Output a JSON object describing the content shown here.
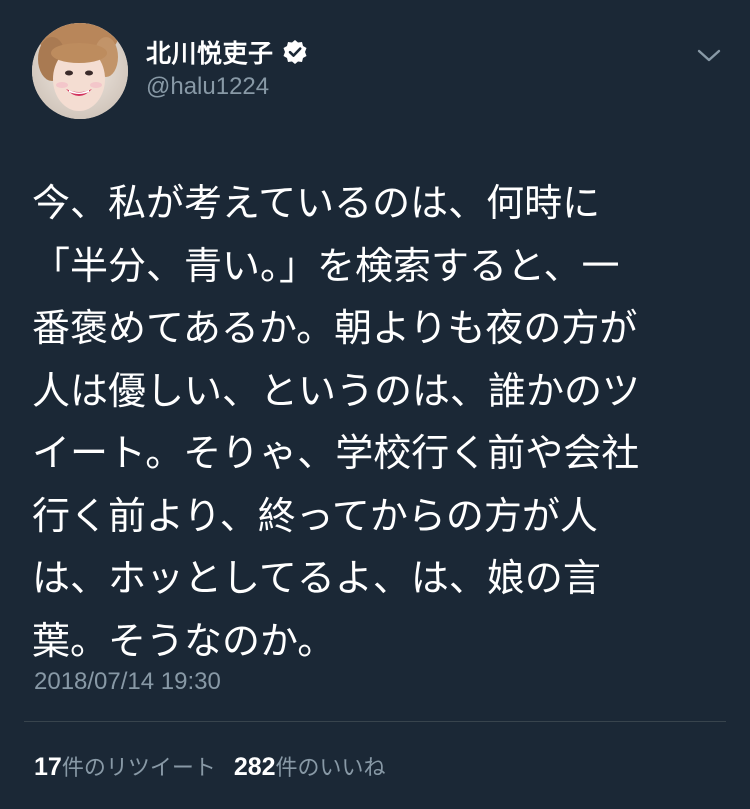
{
  "author": {
    "display_name": "北川悦吏子",
    "handle": "@halu1224",
    "verified": true
  },
  "tweet": {
    "lines": [
      "今、私が考えているのは、何時に",
      "「半分、青い。」を検索すると、一",
      "番褒めてあるか。朝よりも夜の方が",
      "人は優しい、というのは、誰かのツ",
      "イート。そりゃ、学校行く前や会社",
      "行く前より、終ってからの方が人",
      "は、ホッとしてるよ、は、娘の言",
      "葉。そうなのか。"
    ],
    "timestamp": "2018/07/14 19:30"
  },
  "stats": {
    "retweets_count": "17",
    "retweets_label": "件のリツイート",
    "likes_count": "282",
    "likes_label": "件のいいね"
  },
  "icons": {
    "verified": "verified-badge-icon",
    "menu": "chevron-down-icon"
  },
  "colors": {
    "background": "#1b2836",
    "text_primary": "#ffffff",
    "text_secondary": "#8899a6",
    "divider": "#38444d"
  }
}
